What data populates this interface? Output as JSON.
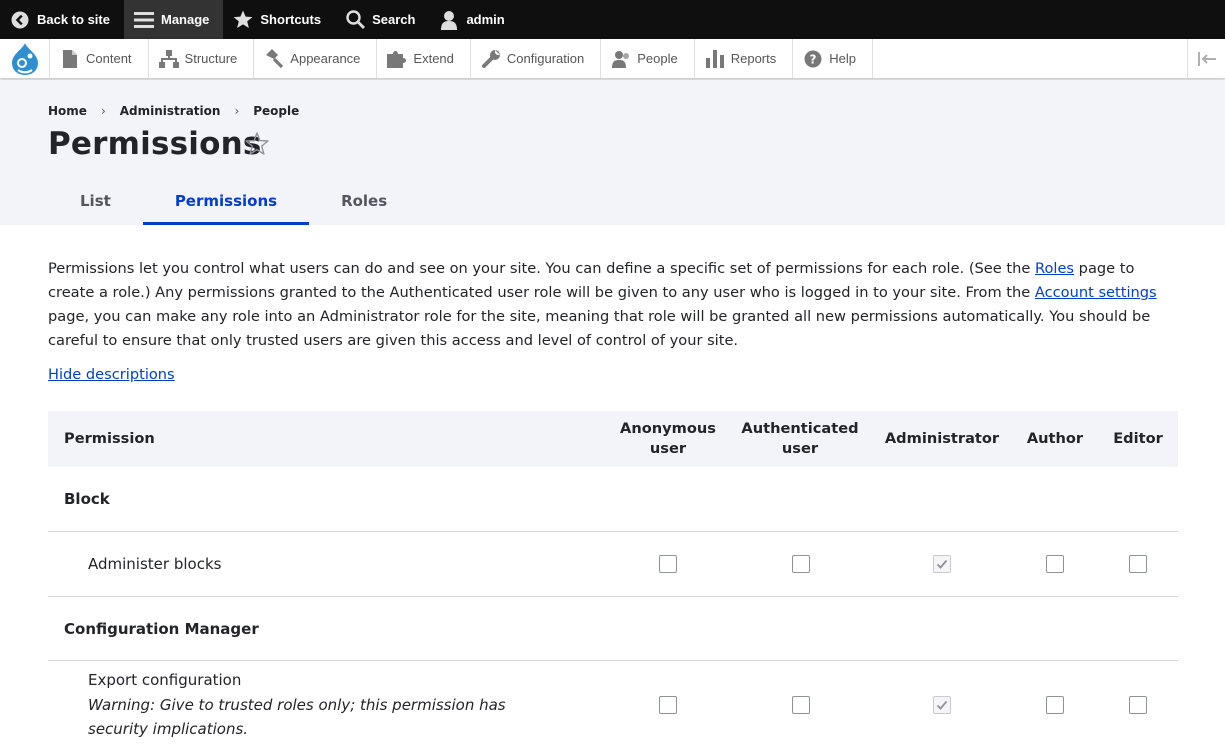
{
  "toolbar": {
    "back_label": "Back to site",
    "manage_label": "Manage",
    "shortcuts_label": "Shortcuts",
    "search_label": "Search",
    "user_label": "admin"
  },
  "tray": {
    "items": [
      {
        "label": "Content",
        "icon": "content-icon"
      },
      {
        "label": "Structure",
        "icon": "structure-icon"
      },
      {
        "label": "Appearance",
        "icon": "appearance-icon"
      },
      {
        "label": "Extend",
        "icon": "extend-icon"
      },
      {
        "label": "Configuration",
        "icon": "configuration-icon"
      },
      {
        "label": "People",
        "icon": "people-icon"
      },
      {
        "label": "Reports",
        "icon": "reports-icon"
      },
      {
        "label": "Help",
        "icon": "help-icon"
      }
    ]
  },
  "breadcrumb": [
    "Home",
    "Administration",
    "People"
  ],
  "page": {
    "title": "Permissions",
    "tabs": [
      {
        "label": "List",
        "active": false
      },
      {
        "label": "Permissions",
        "active": true
      },
      {
        "label": "Roles",
        "active": false
      }
    ]
  },
  "intro": {
    "part1": "Permissions let you control what users can do and see on your site. You can define a specific set of permissions for each role. (See the ",
    "roles_link": "Roles",
    "part2": " page to create a role.) Any permissions granted to the Authenticated user role will be given to any user who is logged in to your site. From the ",
    "account_link": "Account settings",
    "part3": " page, you can make any role into an Administrator role for the site, meaning that role will be granted all new permissions automatically. You should be careful to ensure that only trusted users are given this access and level of control of your site."
  },
  "hide_descriptions": "Hide descriptions",
  "table": {
    "headers": {
      "permission": "Permission",
      "anonymous_1": "Anonymous",
      "anonymous_2": "user",
      "authenticated_1": "Authenticated",
      "authenticated_2": "user",
      "administrator": "Administrator",
      "author": "Author",
      "editor": "Editor"
    },
    "groups": [
      {
        "name": "Block",
        "permissions": [
          {
            "name": "Administer blocks",
            "warning": "",
            "checked": [
              false,
              false,
              true,
              false,
              false
            ]
          }
        ]
      },
      {
        "name": "Configuration Manager",
        "permissions": [
          {
            "name": "Export configuration",
            "warning": "Warning: Give to trusted roles only; this permission has security implications.",
            "checked": [
              false,
              false,
              true,
              false,
              false
            ]
          }
        ]
      }
    ]
  },
  "colors": {
    "accent": "#003ecc",
    "toolbar_bg": "#0f0f0f",
    "header_bg": "#f3f4f9",
    "drupal_blue": "#2f8fd0"
  }
}
